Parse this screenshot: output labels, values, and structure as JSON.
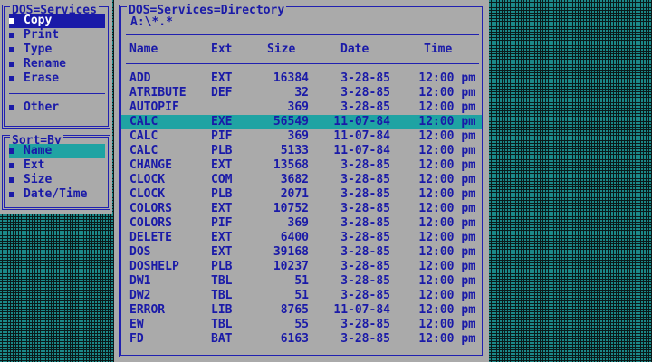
{
  "services": {
    "title": "DOS=Services",
    "items": [
      {
        "label": "Copy",
        "selected": true
      },
      {
        "label": "Print"
      },
      {
        "label": "Type"
      },
      {
        "label": "Rename"
      },
      {
        "label": "Erase"
      }
    ],
    "other": "Other"
  },
  "sort": {
    "title": "Sort=By",
    "items": [
      {
        "label": "Name",
        "selected": true
      },
      {
        "label": "Ext"
      },
      {
        "label": "Size"
      },
      {
        "label": "Date/Time"
      }
    ]
  },
  "directory": {
    "title": "DOS=Services=Directory",
    "path": "A:\\*.*",
    "columns": {
      "name": "Name",
      "ext": "Ext",
      "size": "Size",
      "date": "Date",
      "time": "Time"
    },
    "files": [
      {
        "name": "ADD",
        "ext": "EXT",
        "size": "16384",
        "date": "3-28-85",
        "time": "12:00 pm"
      },
      {
        "name": "ATRIBUTE",
        "ext": "DEF",
        "size": "32",
        "date": "3-28-85",
        "time": "12:00 pm"
      },
      {
        "name": "AUTOPIF",
        "ext": "",
        "size": "369",
        "date": "3-28-85",
        "time": "12:00 pm"
      },
      {
        "name": "CALC",
        "ext": "EXE",
        "size": "56549",
        "date": "11-07-84",
        "time": "12:00 pm",
        "highlighted": true
      },
      {
        "name": "CALC",
        "ext": "PIF",
        "size": "369",
        "date": "11-07-84",
        "time": "12:00 pm"
      },
      {
        "name": "CALC",
        "ext": "PLB",
        "size": "5133",
        "date": "11-07-84",
        "time": "12:00 pm"
      },
      {
        "name": "CHANGE",
        "ext": "EXT",
        "size": "13568",
        "date": "3-28-85",
        "time": "12:00 pm"
      },
      {
        "name": "CLOCK",
        "ext": "COM",
        "size": "3682",
        "date": "3-28-85",
        "time": "12:00 pm"
      },
      {
        "name": "CLOCK",
        "ext": "PLB",
        "size": "2071",
        "date": "3-28-85",
        "time": "12:00 pm"
      },
      {
        "name": "COLORS",
        "ext": "EXT",
        "size": "10752",
        "date": "3-28-85",
        "time": "12:00 pm"
      },
      {
        "name": "COLORS",
        "ext": "PIF",
        "size": "369",
        "date": "3-28-85",
        "time": "12:00 pm"
      },
      {
        "name": "DELETE",
        "ext": "EXT",
        "size": "6400",
        "date": "3-28-85",
        "time": "12:00 pm"
      },
      {
        "name": "DOS",
        "ext": "EXT",
        "size": "39168",
        "date": "3-28-85",
        "time": "12:00 pm"
      },
      {
        "name": "DOSHELP",
        "ext": "PLB",
        "size": "10237",
        "date": "3-28-85",
        "time": "12:00 pm"
      },
      {
        "name": "DW1",
        "ext": "TBL",
        "size": "51",
        "date": "3-28-85",
        "time": "12:00 pm"
      },
      {
        "name": "DW2",
        "ext": "TBL",
        "size": "51",
        "date": "3-28-85",
        "time": "12:00 pm"
      },
      {
        "name": "ERROR",
        "ext": "LIB",
        "size": "8765",
        "date": "11-07-84",
        "time": "12:00 pm"
      },
      {
        "name": "EW",
        "ext": "TBL",
        "size": "55",
        "date": "3-28-85",
        "time": "12:00 pm"
      },
      {
        "name": "FD",
        "ext": "BAT",
        "size": "6163",
        "date": "3-28-85",
        "time": "12:00 pm"
      }
    ]
  },
  "colors": {
    "frame": "#2020b0",
    "window": "#aaaaaa",
    "highlight": "#1fa3a3",
    "selected": "#1a1aa8"
  }
}
